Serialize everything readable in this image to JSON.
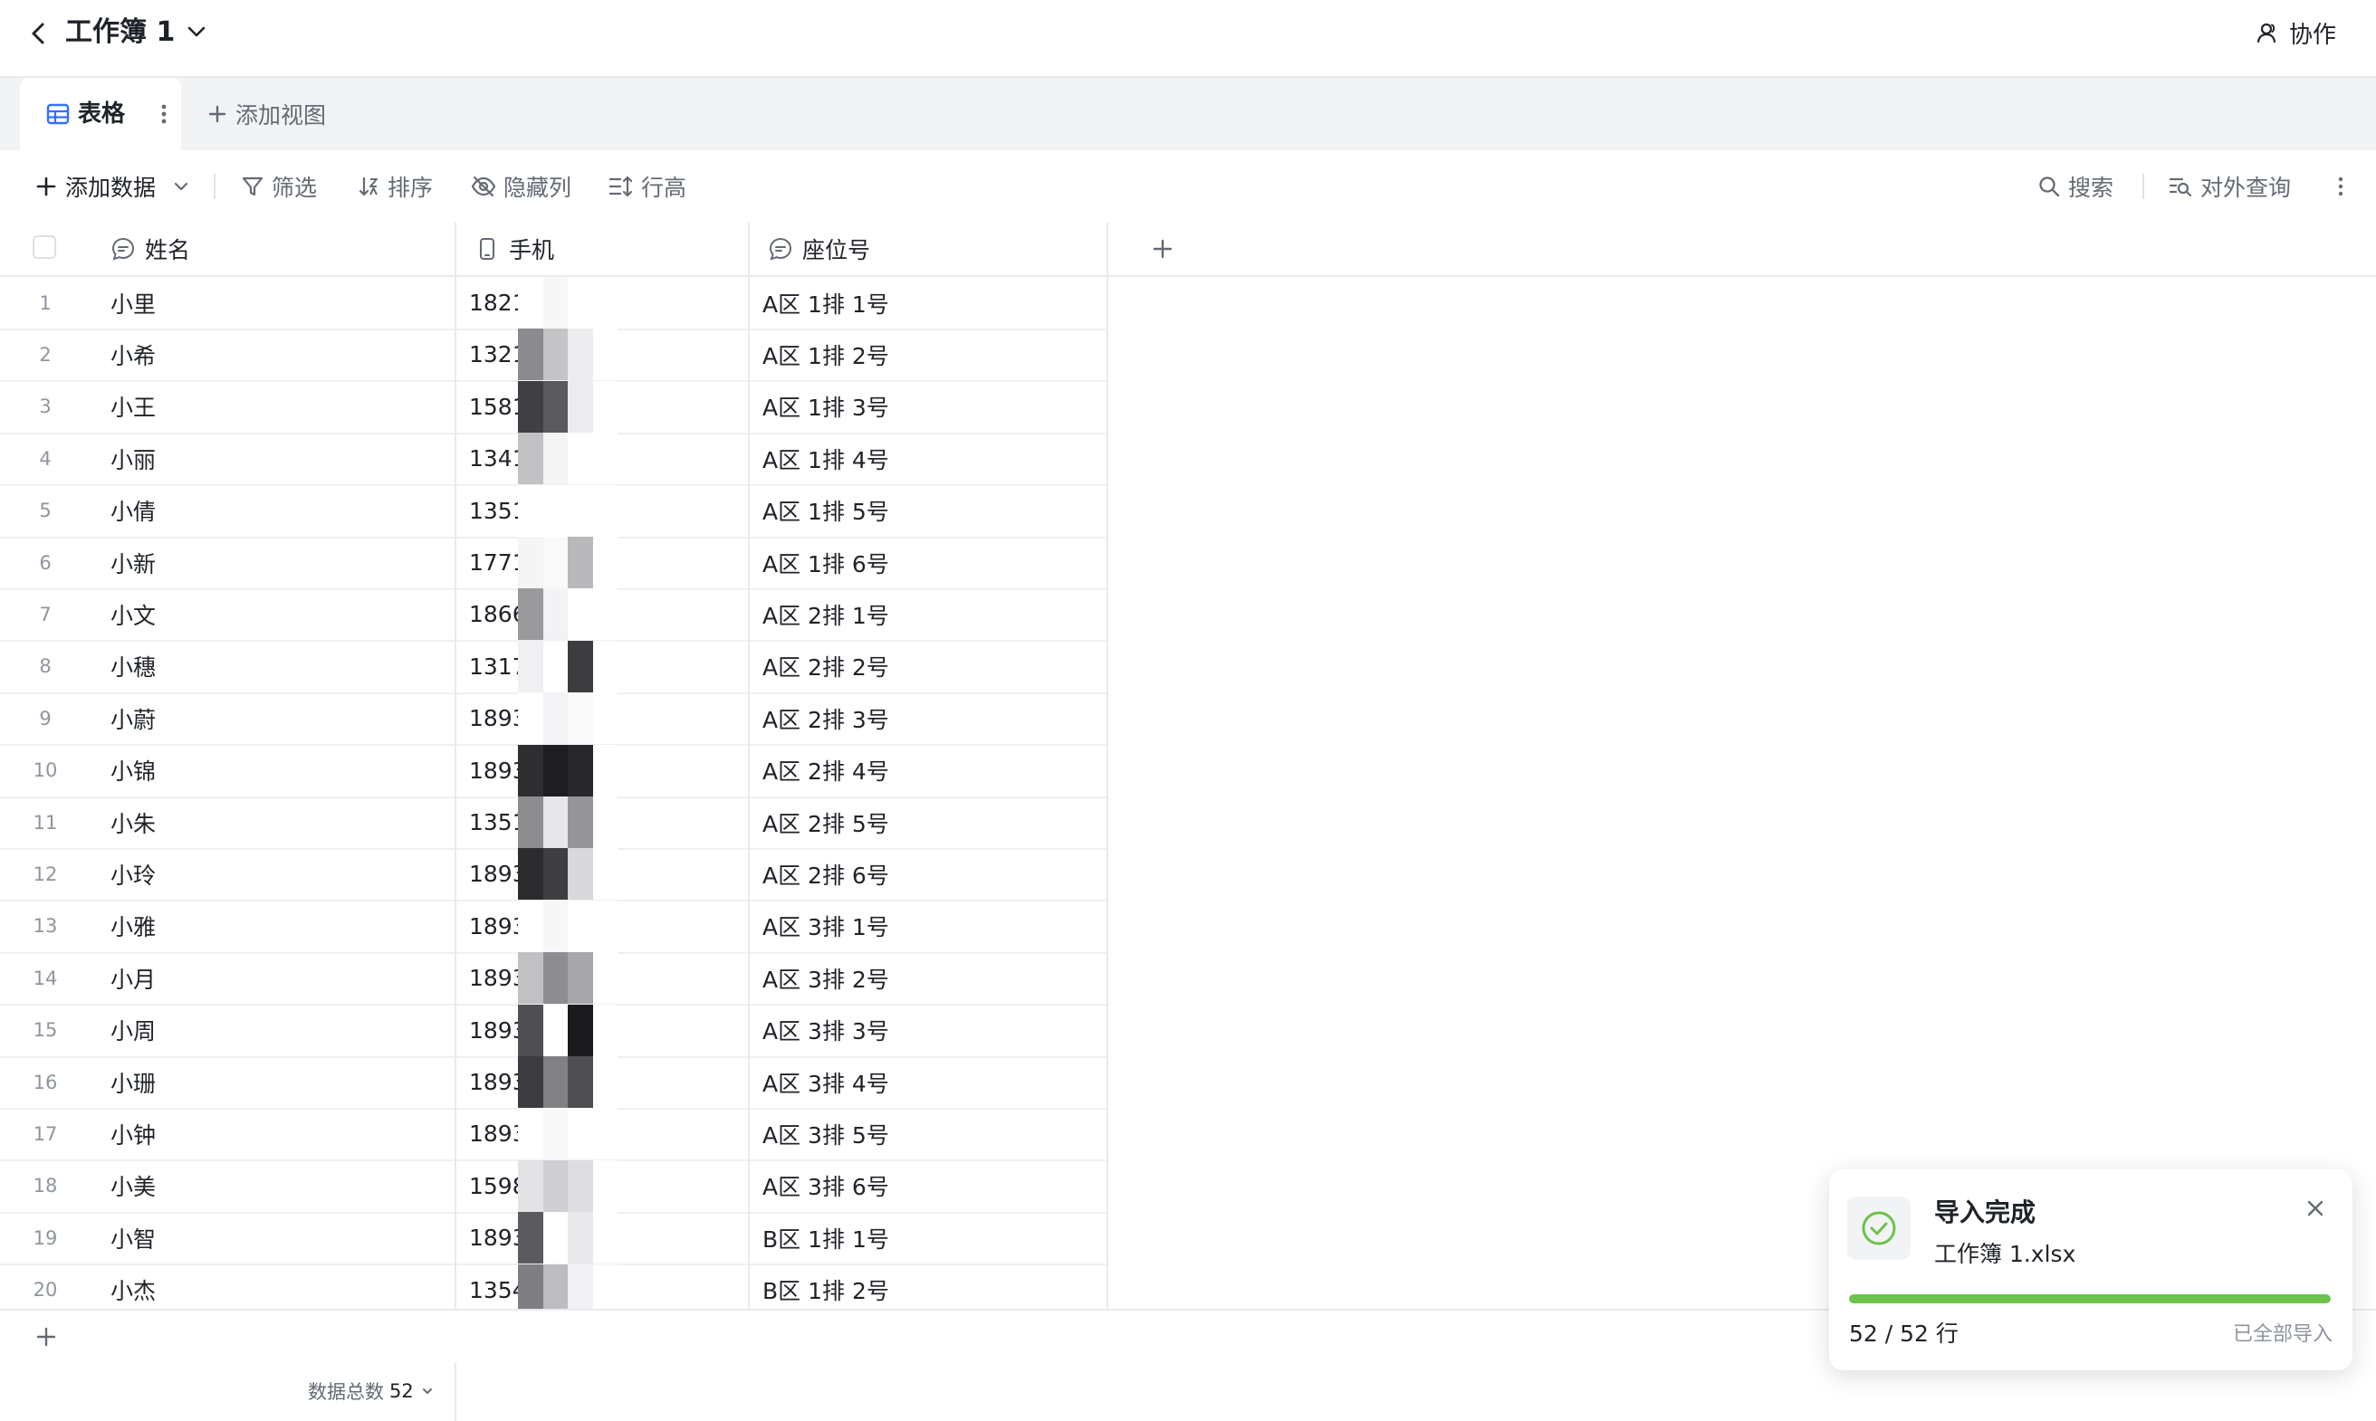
{
  "header": {
    "title": "工作簿 1",
    "collab_label": "协作"
  },
  "tabs": {
    "active_label": "表格",
    "add_view_label": "添加视图"
  },
  "toolbar": {
    "add_data_label": "添加数据",
    "filter_label": "筛选",
    "sort_label": "排序",
    "hide_columns_label": "隐藏列",
    "row_height_label": "行高",
    "search_label": "搜索",
    "public_query_label": "对外查询"
  },
  "columns": {
    "name": "姓名",
    "phone": "手机",
    "seat": "座位号"
  },
  "rows": [
    {
      "num": "1",
      "name": "小里",
      "phone": "1821",
      "seat": "A区 1排 1号",
      "blur": [
        "#ffffff",
        "#f7f7f8",
        "#ffffff",
        "#ffffff"
      ]
    },
    {
      "num": "2",
      "name": "小希",
      "phone": "1321",
      "seat": "A区 1排 2号",
      "blur": [
        "#8b8b8f",
        "#c4c4c7",
        "#ededf0",
        "#ffffff"
      ]
    },
    {
      "num": "3",
      "name": "小王",
      "phone": "1581",
      "seat": "A区 1排 3号",
      "blur": [
        "#404044",
        "#5a5a5e",
        "#ececef",
        "#ffffff"
      ]
    },
    {
      "num": "4",
      "name": "小丽",
      "phone": "1341",
      "seat": "A区 1排 4号",
      "blur": [
        "#c2c2c5",
        "#f4f4f5",
        "#ffffff",
        "#ffffff"
      ]
    },
    {
      "num": "5",
      "name": "小倩",
      "phone": "1351",
      "seat": "A区 1排 5号",
      "blur": [
        "#ffffff",
        "#ffffff",
        "#ffffff",
        "#ffffff"
      ]
    },
    {
      "num": "6",
      "name": "小新",
      "phone": "1771",
      "seat": "A区 1排 6号",
      "blur": [
        "#f5f5f6",
        "#f9f9fa",
        "#b9b9bc",
        "#ffffff"
      ]
    },
    {
      "num": "7",
      "name": "小文",
      "phone": "1866",
      "seat": "A区 2排 1号",
      "blur": [
        "#9a9a9d",
        "#f3f3f5",
        "#ffffff",
        "#ffffff"
      ]
    },
    {
      "num": "8",
      "name": "小穗",
      "phone": "1317",
      "seat": "A区 2排 2号",
      "blur": [
        "#f0f0f2",
        "#ffffff",
        "#3d3d40",
        "#ffffff"
      ]
    },
    {
      "num": "9",
      "name": "小蔚",
      "phone": "1893",
      "seat": "A区 2排 3号",
      "blur": [
        "#ffffff",
        "#f4f4f6",
        "#fafafb",
        "#ffffff"
      ]
    },
    {
      "num": "10",
      "name": "小锦",
      "phone": "1893",
      "seat": "A区 2排 4号",
      "blur": [
        "#2e2e31",
        "#1e1e21",
        "#28282b",
        "#ffffff"
      ]
    },
    {
      "num": "11",
      "name": "小朱",
      "phone": "1351",
      "seat": "A区 2排 5号",
      "blur": [
        "#8d8d90",
        "#e7e7ea",
        "#959598",
        "#ffffff"
      ]
    },
    {
      "num": "12",
      "name": "小玲",
      "phone": "1893",
      "seat": "A区 2排 6号",
      "blur": [
        "#2c2c2f",
        "#3f3f43",
        "#d9d9dd",
        "#ffffff"
      ]
    },
    {
      "num": "13",
      "name": "小雅",
      "phone": "1893",
      "seat": "A区 3排 1号",
      "blur": [
        "#ffffff",
        "#f7f7f8",
        "#ffffff",
        "#ffffff"
      ]
    },
    {
      "num": "14",
      "name": "小月",
      "phone": "1893",
      "seat": "A区 3排 2号",
      "blur": [
        "#c1c1c4",
        "#8e8e91",
        "#a7a7aa",
        "#ffffff"
      ]
    },
    {
      "num": "15",
      "name": "小周",
      "phone": "1893",
      "seat": "A区 3排 3号",
      "blur": [
        "#505054",
        "#ffffff",
        "#1b1b1e",
        "#ffffff"
      ]
    },
    {
      "num": "16",
      "name": "小珊",
      "phone": "1893",
      "seat": "A区 3排 4号",
      "blur": [
        "#3c3c40",
        "#818185",
        "#4f4f53",
        "#ffffff"
      ]
    },
    {
      "num": "17",
      "name": "小钟",
      "phone": "1893",
      "seat": "A区 3排 5号",
      "blur": [
        "#ffffff",
        "#f8f8f9",
        "#ffffff",
        "#ffffff"
      ]
    },
    {
      "num": "18",
      "name": "小美",
      "phone": "1598",
      "seat": "A区 3排 6号",
      "blur": [
        "#e3e3e6",
        "#cfcfd2",
        "#dedee1",
        "#ffffff"
      ]
    },
    {
      "num": "19",
      "name": "小智",
      "phone": "1893",
      "seat": "B区 1排 1号",
      "blur": [
        "#5b5b5f",
        "#ffffff",
        "#e9e9ec",
        "#ffffff"
      ]
    },
    {
      "num": "20",
      "name": "小杰",
      "phone": "1354",
      "seat": "B区 1排 2号",
      "blur": [
        "#7f7f83",
        "#bdbdc0",
        "#f2f2f4",
        "#ffffff"
      ]
    }
  ],
  "footer": {
    "total_label": "数据总数",
    "total_count": "52"
  },
  "toast": {
    "title": "导入完成",
    "file_name": "工作簿 1.xlsx",
    "progress_text": "52 / 52 行",
    "progress_fraction": 1.0,
    "status_text": "已全部导入"
  },
  "colors": {
    "accent_green": "#6cc24a",
    "border": "#e8eaed",
    "muted_text": "#646a73"
  }
}
